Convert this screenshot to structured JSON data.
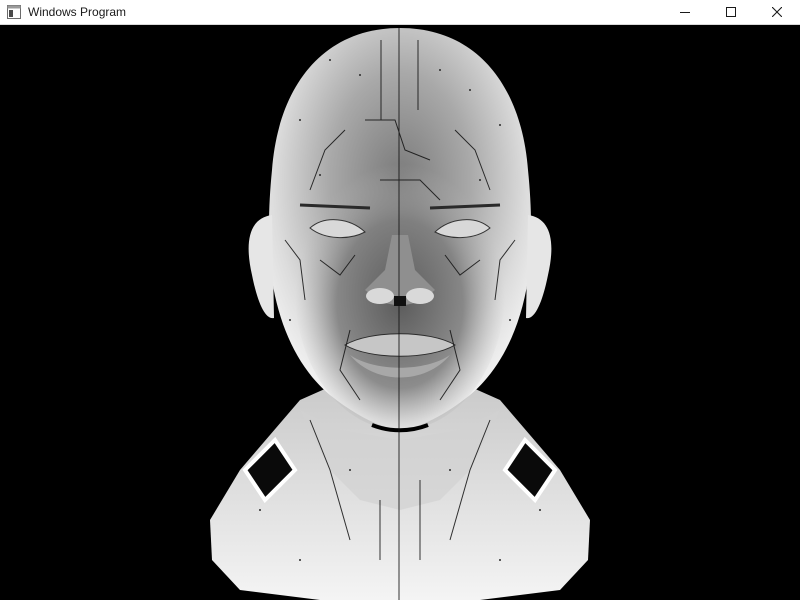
{
  "window": {
    "title": "Windows Program",
    "icons": {
      "app": "window-app-icon",
      "minimize": "minimize-icon",
      "maximize": "maximize-icon",
      "close": "close-icon"
    }
  },
  "viewport": {
    "background_color": "#000000",
    "model_color": "#e8e8e8",
    "shade_color": "#6a6a6a",
    "edge_color": "#111111"
  }
}
